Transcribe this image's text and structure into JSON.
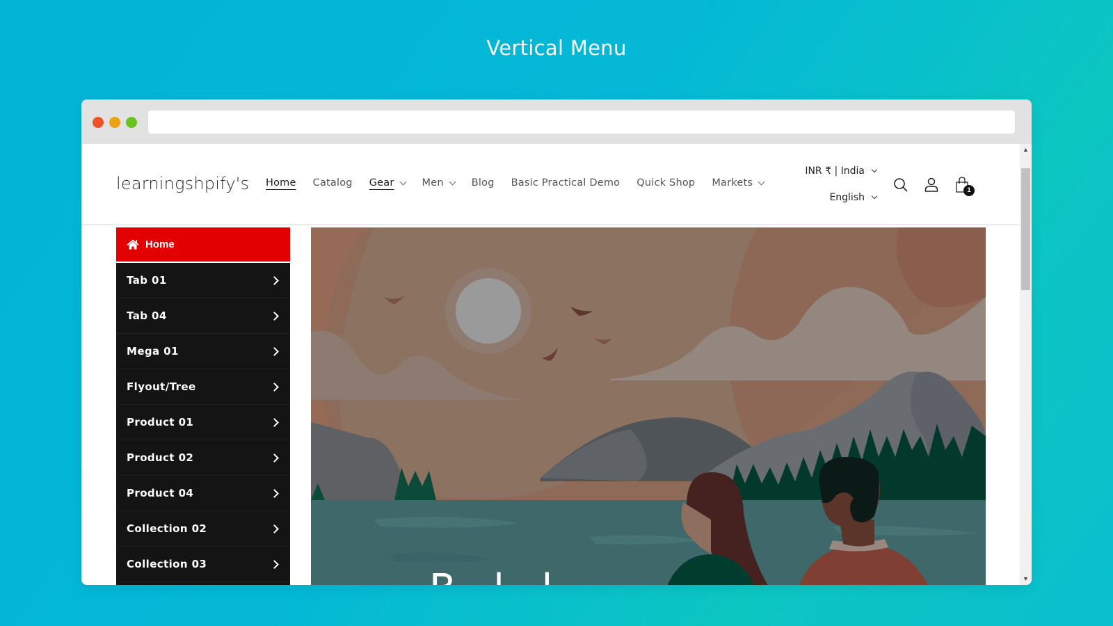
{
  "page": {
    "title": "Vertical Menu"
  },
  "browser": {
    "url": "",
    "window_controls": [
      "close",
      "minimize",
      "maximize"
    ]
  },
  "store": {
    "logo": "learningshpify's",
    "nav": [
      {
        "label": "Home",
        "active": true,
        "dropdown": false
      },
      {
        "label": "Catalog",
        "active": false,
        "dropdown": false
      },
      {
        "label": "Gear",
        "active": true,
        "dropdown": true
      },
      {
        "label": "Men",
        "active": false,
        "dropdown": true
      },
      {
        "label": "Blog",
        "active": false,
        "dropdown": false
      },
      {
        "label": "Basic Practical Demo",
        "active": false,
        "dropdown": false
      },
      {
        "label": "Quick Shop",
        "active": false,
        "dropdown": false
      },
      {
        "label": "Markets",
        "active": false,
        "dropdown": true
      }
    ],
    "currency_selector": "INR ₹ | India",
    "language_selector": "English",
    "header_icons": [
      "search-icon",
      "account-icon",
      "cart-icon"
    ],
    "cart_count": "1"
  },
  "vertical_menu": {
    "home": {
      "label": "Home",
      "icon": "home-icon",
      "color": "#e30000"
    },
    "items": [
      {
        "label": "Tab 01"
      },
      {
        "label": "Tab 04"
      },
      {
        "label": "Mega 01"
      },
      {
        "label": "Flyout/Tree"
      },
      {
        "label": "Product 01"
      },
      {
        "label": "Product 02"
      },
      {
        "label": "Product 04"
      },
      {
        "label": "Collection 02"
      },
      {
        "label": "Collection 03"
      }
    ]
  },
  "hero": {
    "image": "illustration of two people looking at mountains, lake and moon",
    "heading_partial": "B          l          l"
  },
  "colors": {
    "accent": "#e30000",
    "menu_bg": "#141414",
    "background_gradient": [
      "#02b4d6",
      "#0cc6c2"
    ]
  }
}
